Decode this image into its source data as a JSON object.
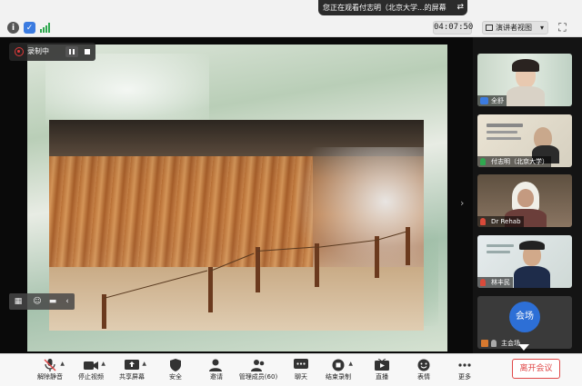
{
  "topbar": {
    "notice": "您正在观看付志明（北京大学...的屏幕",
    "notice_icon": "swap-icon",
    "timer": "04:07:50",
    "view_label": "演讲者视图",
    "status_icons": [
      "info-icon",
      "shield-icon",
      "signal-icon"
    ]
  },
  "recording": {
    "label": "录制中"
  },
  "participants": [
    {
      "name": "全舒",
      "icon": "host-icon"
    },
    {
      "name": "付志明（北京大学）",
      "icon": "mic-icon"
    },
    {
      "name": "Dr Rehab",
      "icon": "mic-muted-icon"
    },
    {
      "name": "林丰民",
      "icon": "mic-muted-icon"
    }
  ],
  "venue": {
    "avatar_text": "会场",
    "name": "主会场"
  },
  "toolbar": {
    "items": [
      {
        "label": "解除静音",
        "icon": "mic-muted-icon"
      },
      {
        "label": "停止视频",
        "icon": "video-icon"
      },
      {
        "label": "共享屏幕",
        "icon": "share-screen-icon"
      },
      {
        "label": "安全",
        "icon": "shield-icon"
      },
      {
        "label": "邀请",
        "icon": "invite-icon"
      },
      {
        "label": "管理成员(60)",
        "icon": "members-icon"
      },
      {
        "label": "聊天",
        "icon": "chat-icon"
      },
      {
        "label": "结束录制",
        "icon": "stop-record-icon"
      },
      {
        "label": "直播",
        "icon": "live-icon"
      },
      {
        "label": "表情",
        "icon": "emoji-icon"
      },
      {
        "label": "更多",
        "icon": "more-icon"
      }
    ],
    "leave_label": "离开会议"
  },
  "colors": {
    "leave": "#e04848",
    "venue_avatar": "#2d6fd6",
    "recording": "#e23a3a"
  }
}
